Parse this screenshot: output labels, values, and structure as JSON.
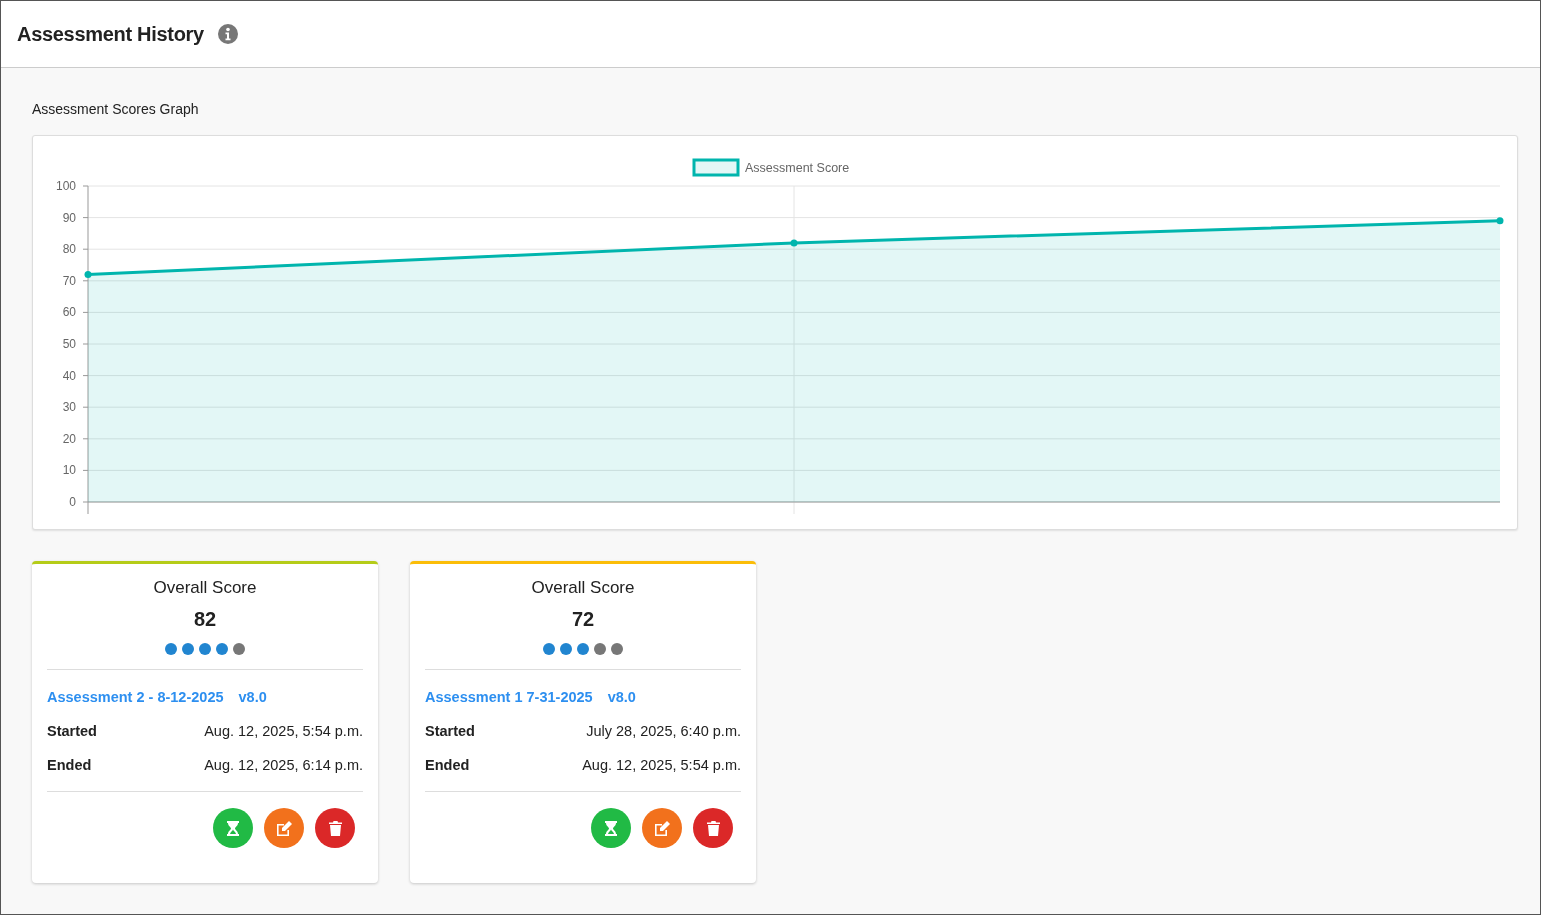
{
  "header": {
    "title": "Assessment History"
  },
  "graph": {
    "title": "Assessment Scores Graph",
    "chart_data": {
      "type": "area",
      "grid": true,
      "ylim": [
        0,
        100
      ],
      "yticks": [
        0,
        10,
        20,
        30,
        40,
        50,
        60,
        70,
        80,
        90,
        100
      ],
      "series": [
        {
          "name": "Assessment Score",
          "color": "#00b5ad",
          "values": [
            72,
            82,
            89
          ]
        }
      ]
    }
  },
  "cards": [
    {
      "color": "#b5cc18",
      "label": "Overall Score",
      "score": "82",
      "stars": 4,
      "assessment": "Assessment 2 - 8-12-2025",
      "version": "v8.0",
      "started_label": "Started",
      "started": "Aug. 12, 2025, 5:54 p.m.",
      "ended_label": "Ended",
      "ended": "Aug. 12, 2025, 6:14 p.m."
    },
    {
      "color": "#fbbd08",
      "label": "Overall Score",
      "score": "72",
      "stars": 3,
      "assessment": "Assessment 1 7-31-2025",
      "version": "v8.0",
      "started_label": "Started",
      "started": "July 28, 2025, 6:40 p.m.",
      "ended_label": "Ended",
      "ended": "Aug. 12, 2025, 5:54 p.m."
    }
  ]
}
